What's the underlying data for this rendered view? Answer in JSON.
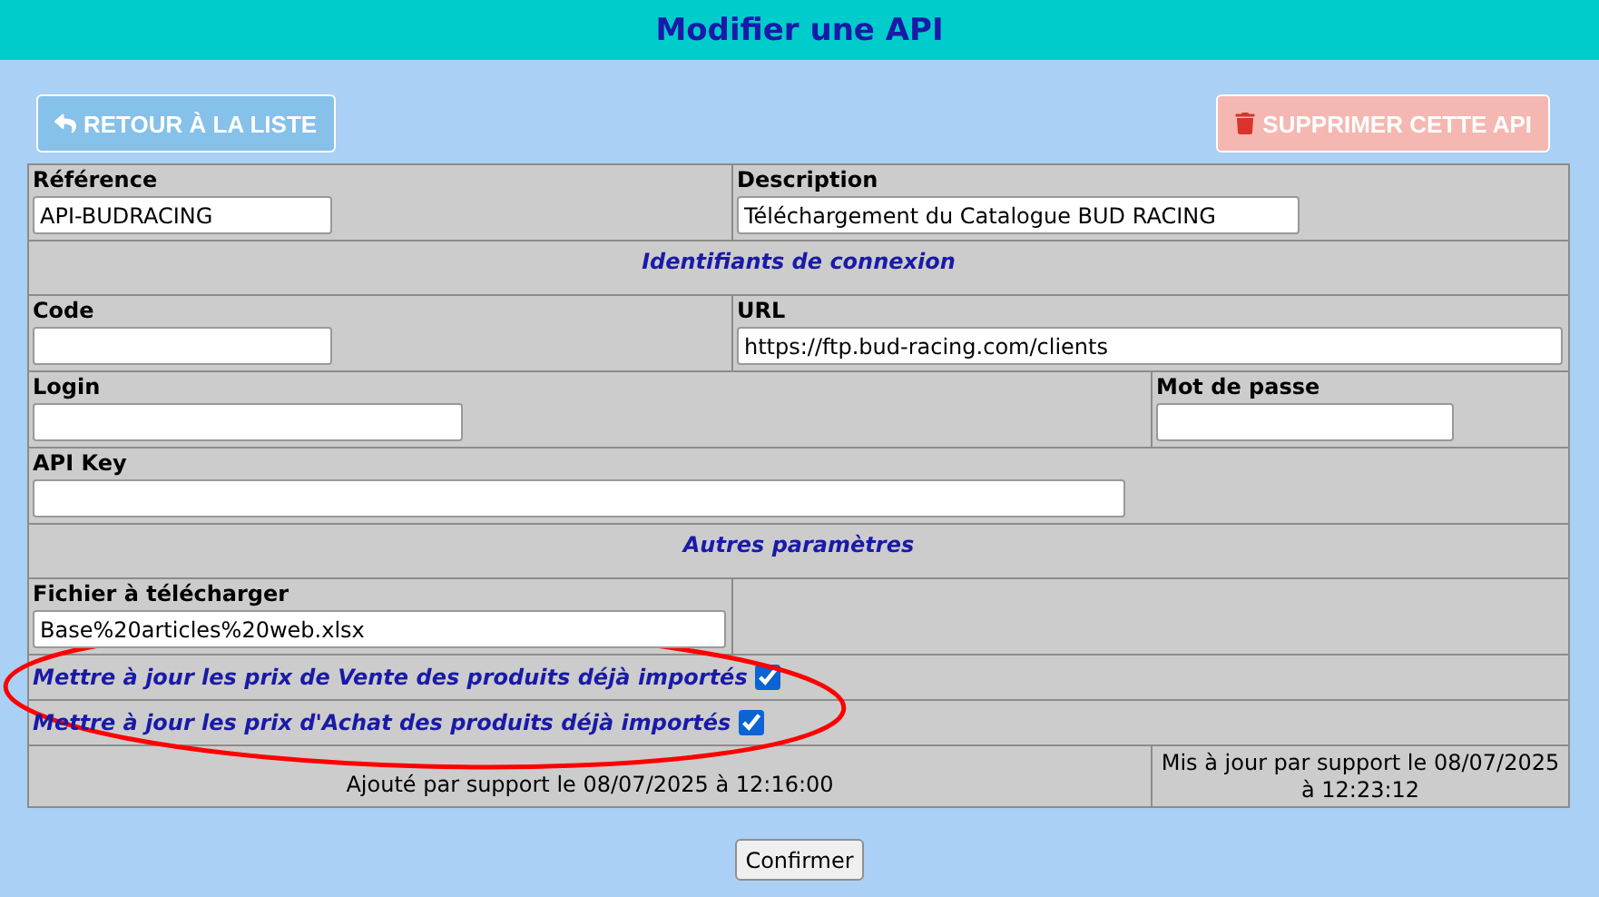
{
  "title": "Modifier une API",
  "back_button": {
    "label": "RETOUR À LA LISTE"
  },
  "delete_button": {
    "label": "SUPPRIMER CETTE API"
  },
  "fields": [
    {
      "label": "Référence",
      "value": "API-BUDRACING"
    },
    {
      "label": "Description",
      "value": "Téléchargement du Catalogue BUD RACING"
    },
    {
      "label": "Code"
    },
    {
      "label": "URL",
      "value": "https://ftp.bud-racing.com/clients"
    },
    {
      "label": "Login"
    },
    {
      "label": "Mot de passe"
    },
    {
      "label": "API Key"
    },
    {
      "label": "Fichier à télécharger",
      "value": "Base%20articles%20web.xlsx"
    }
  ],
  "sections": [
    "Identifiants de connexion",
    "Autres paramètres"
  ],
  "options": [
    {
      "label": "Mettre à jour les prix de Vente des produits déjà importés",
      "checked": true
    },
    {
      "label": "Mettre à jour les prix d'Achat des produits déjà importés",
      "checked": true
    }
  ],
  "footer": {
    "created": "Ajouté par support le 08/07/2025 à 12:16:00",
    "updated": "Mis à jour par support le 08/07/2025 à 12:23:12"
  },
  "confirm_button": {
    "label": "Confirmer"
  },
  "annotation": {
    "kind": "ellipse"
  }
}
